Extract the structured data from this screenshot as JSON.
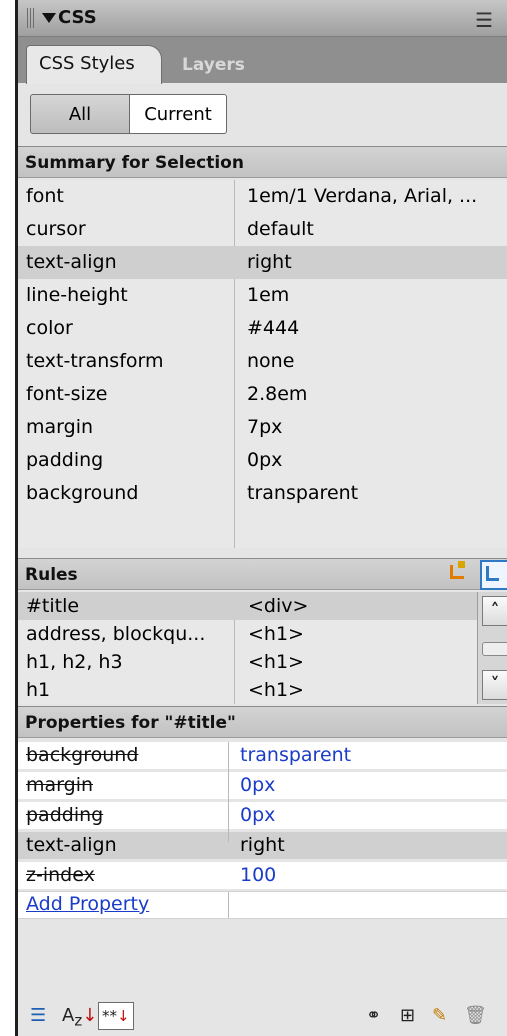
{
  "panel": {
    "title": "CSS",
    "menu_icon": "options-menu-icon"
  },
  "tabs": [
    {
      "label": "CSS Styles",
      "active": true
    },
    {
      "label": "Layers",
      "active": false
    }
  ],
  "mode_toggle": {
    "all": "All",
    "current": "Current",
    "selected": "Current"
  },
  "summary": {
    "header": "Summary for Selection",
    "rows": [
      {
        "prop": "font",
        "value": "1em/1 Verdana, Arial, ..."
      },
      {
        "prop": "cursor",
        "value": "default"
      },
      {
        "prop": "text-align",
        "value": "right"
      },
      {
        "prop": "line-height",
        "value": "1em"
      },
      {
        "prop": "color",
        "value": "#444"
      },
      {
        "prop": "text-transform",
        "value": "none"
      },
      {
        "prop": "font-size",
        "value": "2.8em"
      },
      {
        "prop": "margin",
        "value": "7px"
      },
      {
        "prop": "padding",
        "value": "0px"
      },
      {
        "prop": "background",
        "value": "transparent"
      }
    ]
  },
  "rules": {
    "header": "Rules",
    "rows": [
      {
        "selector": "#title",
        "tag": "<div>"
      },
      {
        "selector": "address, blockqu...",
        "tag": "<h1>"
      },
      {
        "selector": "h1, h2, h3",
        "tag": "<h1>"
      },
      {
        "selector": "h1",
        "tag": "<h1>"
      }
    ]
  },
  "properties": {
    "header": "Properties for \"#title\"",
    "rows": [
      {
        "prop": "background",
        "value": "transparent"
      },
      {
        "prop": "margin",
        "value": "0px"
      },
      {
        "prop": "padding",
        "value": "0px"
      },
      {
        "prop": "text-align",
        "value": "right"
      },
      {
        "prop": "z-index",
        "value": "100"
      }
    ],
    "add_label": "Add Property"
  },
  "toolbar": {
    "az": "A",
    "z": "z",
    "star": "**"
  },
  "colors": {
    "link_blue": "#1a3cc8",
    "selected_row": "#cfcfcf",
    "tab_bar": "#8f8f8f"
  }
}
